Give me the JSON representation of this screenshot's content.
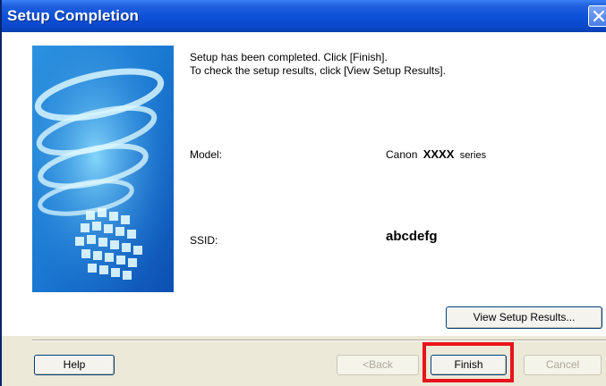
{
  "window": {
    "title": "Setup Completion"
  },
  "message": {
    "line1": "Setup has been completed. Click [Finish].",
    "line2": "To check the setup results, click [View Setup Results]."
  },
  "model": {
    "label": "Model:",
    "value_prefix": "Canon",
    "value_name": "XXXX",
    "value_suffix": "series"
  },
  "ssid": {
    "label": "SSID:",
    "value": "abcdefg"
  },
  "buttons": {
    "view_results": "View Setup Results...",
    "help": "Help",
    "back": "<Back",
    "finish": "Finish",
    "cancel": "Cancel"
  },
  "colors": {
    "titlebar": "#0a48c9",
    "highlight": "#e8141b",
    "dialog_bg": "#ece9d8"
  }
}
